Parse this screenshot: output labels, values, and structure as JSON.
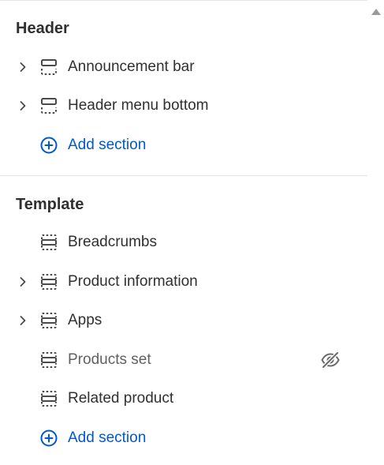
{
  "groups": [
    {
      "title": "Header",
      "items": [
        {
          "label": "Announcement bar",
          "expandable": true,
          "icon": "section-icon",
          "hidden": false
        },
        {
          "label": "Header menu bottom",
          "expandable": true,
          "icon": "section-icon",
          "hidden": false
        }
      ],
      "add_label": "Add section"
    },
    {
      "title": "Template",
      "items": [
        {
          "label": "Breadcrumbs",
          "expandable": false,
          "icon": "section-icon",
          "hidden": false
        },
        {
          "label": "Product information",
          "expandable": true,
          "icon": "section-icon",
          "hidden": false
        },
        {
          "label": "Apps",
          "expandable": true,
          "icon": "section-icon",
          "hidden": false
        },
        {
          "label": "Products set",
          "expandable": false,
          "icon": "section-icon",
          "hidden": true
        },
        {
          "label": "Related product",
          "expandable": false,
          "icon": "section-icon",
          "hidden": false
        }
      ],
      "add_label": "Add section"
    }
  ],
  "colors": {
    "accent": "#0059c7",
    "text": "#303030",
    "muted": "#616161"
  }
}
